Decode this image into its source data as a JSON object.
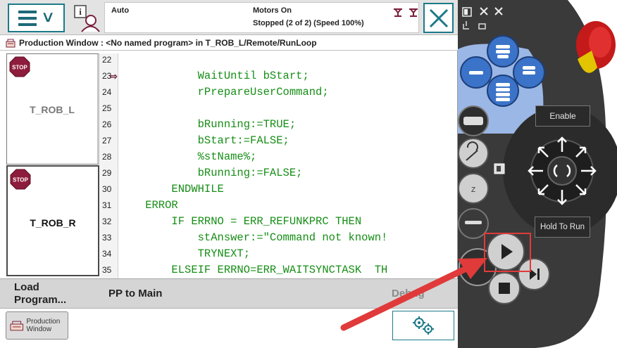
{
  "header": {
    "mode": "Auto",
    "motors_status": "Motors On",
    "run_status": "Stopped (2 of 2) (Speed 100%)"
  },
  "window_title": "Production Window : <No named program> in T_ROB_L/Remote/RunLoop",
  "tasks": [
    {
      "name": "T_ROB_L"
    },
    {
      "name": "T_ROB_R"
    }
  ],
  "code": {
    "line_numbers": [
      "22",
      "23",
      "24",
      "25",
      "26",
      "27",
      "28",
      "29",
      "30",
      "31",
      "32",
      "33",
      "34",
      "35"
    ],
    "lines": [
      "",
      "            WaitUntil bStart;",
      "            rPrepareUserCommand;",
      "",
      "            bRunning:=TRUE;",
      "            bStart:=FALSE;",
      "            %stName%;",
      "            bRunning:=FALSE;",
      "        ENDWHILE",
      "    ERROR",
      "        IF ERRNO = ERR_REFUNKPRC THEN",
      "            stAnswer:=\"Command not known!",
      "            TRYNEXT;",
      "        ELSEIF ERRNO=ERR_WAITSYNCTASK  TH"
    ]
  },
  "toolbar": {
    "load_program": "Load Program...",
    "pp_to_main": "PP to Main",
    "debug": "Debug"
  },
  "taskbar": {
    "production_window": "Production Window"
  },
  "pendant": {
    "enable": "Enable",
    "hold_to_run": "Hold To Run"
  },
  "colors": {
    "accent": "#1d7a88",
    "code": "#168e16",
    "annotation": "#e03a3a",
    "pendant_blue": "#3b73c8"
  }
}
